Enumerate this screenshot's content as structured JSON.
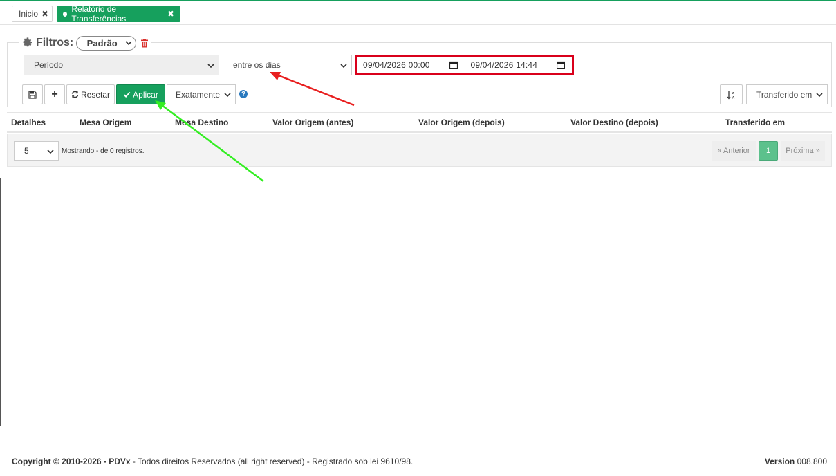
{
  "tabs": [
    {
      "label": "Inicio"
    },
    {
      "label": "Relatório de Transferências"
    }
  ],
  "filters": {
    "title": "Filtros:",
    "preset": "Padrão",
    "field": "Período",
    "operator": "entre os dias",
    "date_from": "09/04/2026 00:00",
    "date_to": "09/04/2026 14:44",
    "reset_label": "Resetar",
    "apply_label": "Aplicar",
    "match_mode": "Exatamente",
    "help": "?",
    "sort_field": "Transferido em"
  },
  "table": {
    "columns": [
      "Detalhes",
      "Mesa Origem",
      "Mesa Destino",
      "Valor Origem (antes)",
      "Valor Origem (depois)",
      "Valor Destino (depois)",
      "Transferido em"
    ]
  },
  "pager": {
    "page_size": "5",
    "showing": "Mostrando - de 0 registros.",
    "prev": "« Anterior",
    "current": "1",
    "next": "Próxima »"
  },
  "footer": {
    "copyright_bold": "Copyright © 2010-2026 - PDVx",
    "copyright_rest": " - Todos direitos Reservados (all right reserved) - Registrado sob lei 9610/98.",
    "version_label": "Version",
    "version_number": "008.800"
  },
  "colors": {
    "brand": "#16a05d",
    "highlight_box": "#d9001b",
    "arrow_red": "#e81f1f",
    "arrow_green": "#33ee22"
  }
}
